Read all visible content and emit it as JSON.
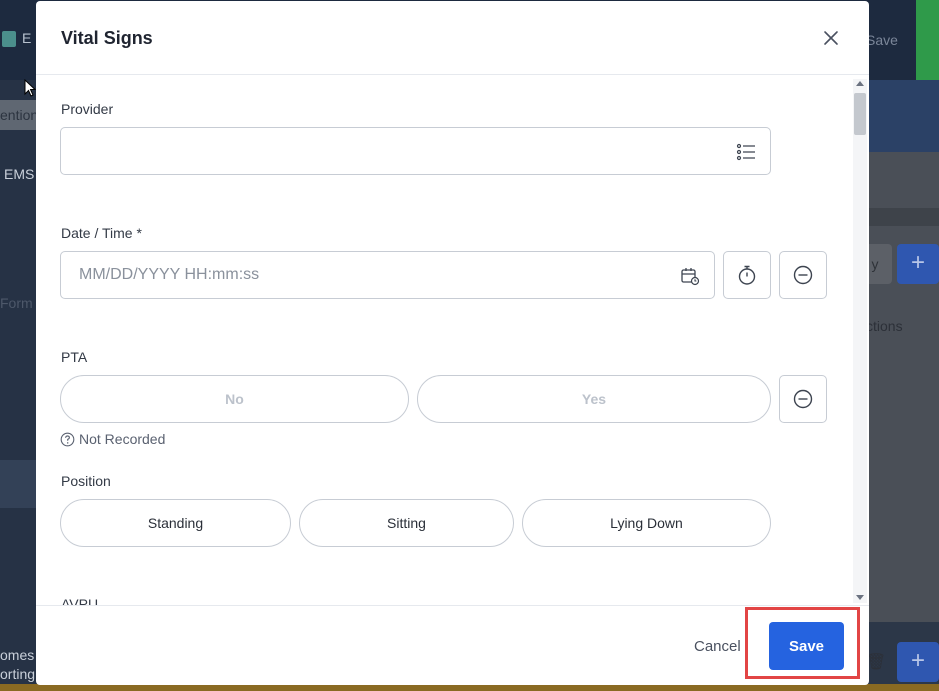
{
  "background": {
    "logo_text": "E",
    "save_text": "Save",
    "tab_text": "ention",
    "ems_text": "EMS",
    "form_text": "Form",
    "homes_text": "omes a",
    "reporting_text": "orting",
    "right_field_text": "y",
    "actions_text": "ctions",
    "plus_symbol": "+",
    "trash_symbol": "🗑",
    "colors": {
      "header": "#1d2a3f",
      "green": "#2f9a4a",
      "blue": "#2563e0"
    }
  },
  "modal": {
    "title": "Vital Signs",
    "close_icon": "close-icon",
    "fields": {
      "provider": {
        "label": "Provider",
        "value": "",
        "icon": "list-icon"
      },
      "datetime": {
        "label": "Date / Time  *",
        "placeholder": "MM/DD/YYYY HH:mm:ss",
        "icon": "calendar-clock-icon",
        "timer_icon": "stopwatch-icon",
        "clear_icon": "minus-circle-icon"
      },
      "pta": {
        "label": "PTA",
        "options": [
          "No",
          "Yes"
        ],
        "clear_icon": "minus-circle-icon",
        "status": "Not Recorded"
      },
      "position": {
        "label": "Position",
        "options": [
          "Standing",
          "Sitting",
          "Lying Down"
        ]
      },
      "avpu": {
        "label": "AVPU"
      }
    },
    "footer": {
      "cancel_label": "Cancel",
      "save_label": "Save"
    }
  }
}
